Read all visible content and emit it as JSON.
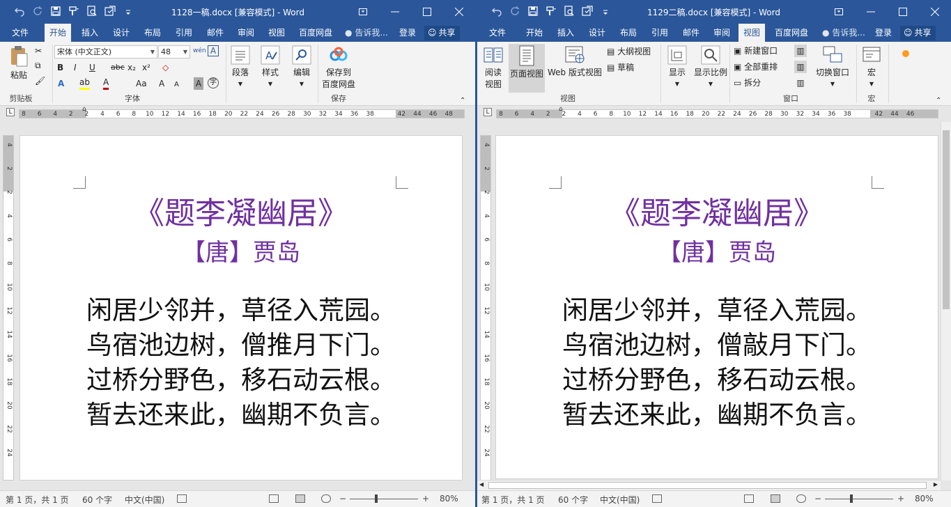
{
  "left_window": {
    "title": "1128一稿.docx [兼容模式] - Word",
    "tabs": [
      "文件",
      "开始",
      "插入",
      "设计",
      "布局",
      "引用",
      "邮件",
      "审阅",
      "视图",
      "百度网盘"
    ],
    "active_tab": "开始",
    "tell_me": "告诉我...",
    "login": "登录",
    "share": "共享",
    "ribbon": {
      "clipboard": {
        "paste": "粘贴",
        "label": "剪贴板"
      },
      "font": {
        "name": "宋体 (中文正文)",
        "size": "48",
        "label": "字体",
        "bold": "B",
        "italic": "I",
        "underline": "U",
        "strike": "abc",
        "sub": "x₂",
        "sup": "x²",
        "grow": "A",
        "shrink": "A"
      },
      "paragraph": "段落",
      "styles": "样式",
      "editing": "编辑",
      "save_to": "保存到",
      "baidu": "百度网盘",
      "save_label": "保存"
    },
    "ruler_numbers": [
      "8",
      "6",
      "4",
      "2",
      "2",
      "4",
      "6",
      "8",
      "10",
      "12",
      "14",
      "16",
      "18",
      "20",
      "22",
      "24",
      "26",
      "28",
      "30",
      "32",
      "34",
      "36",
      "38",
      "42",
      "44",
      "46",
      "48"
    ],
    "vruler_numbers": [
      "4",
      "2",
      "2",
      "4",
      "6",
      "8",
      "10",
      "12",
      "14",
      "16",
      "18",
      "20",
      "22",
      "24"
    ],
    "doc": {
      "title": "《题李凝幽居》",
      "author": "【唐】贾岛",
      "lines": [
        "闲居少邻并，草径入荒园。",
        "鸟宿池边树，僧推月下门。",
        "过桥分野色，移石动云根。",
        "暂去还来此，幽期不负言。"
      ]
    },
    "status": {
      "page": "第 1 页，共 1 页",
      "words": "60 个字",
      "lang": "中文(中国)",
      "zoom": "80%"
    }
  },
  "right_window": {
    "title": "1129二稿.docx [兼容模式] - Word",
    "tabs": [
      "文件",
      "开始",
      "插入",
      "设计",
      "布局",
      "引用",
      "邮件",
      "审阅",
      "视图",
      "百度网盘"
    ],
    "active_tab": "视图",
    "tell_me": "告诉我...",
    "login": "登录",
    "share": "共享",
    "ribbon": {
      "read": "阅读\n视图",
      "read1": "阅读",
      "read2": "视图",
      "page_view": "页面视图",
      "web_view": "Web 版式视图",
      "outline": "大纲视图",
      "draft": "草稿",
      "views_label": "视图",
      "show": "显示",
      "zoom": "显示比例",
      "new_window": "新建窗口",
      "arrange_all": "全部重排",
      "split": "拆分",
      "switch_windows": "切换窗口",
      "window_label": "窗口",
      "macros": "宏",
      "macros_label": "宏"
    },
    "ruler_numbers": [
      "8",
      "6",
      "4",
      "2",
      "2",
      "4",
      "6",
      "8",
      "10",
      "12",
      "14",
      "16",
      "18",
      "20",
      "22",
      "24",
      "26",
      "28",
      "30",
      "32",
      "34",
      "36",
      "38",
      "42",
      "44",
      "46"
    ],
    "vruler_numbers": [
      "4",
      "2",
      "2",
      "4",
      "6",
      "8",
      "10",
      "12",
      "14",
      "16",
      "18",
      "20",
      "22",
      "24"
    ],
    "doc": {
      "title": "《题李凝幽居》",
      "author": "【唐】贾岛",
      "lines": [
        "闲居少邻并，草径入荒园。",
        "鸟宿池边树，僧敲月下门。",
        "过桥分野色，移石动云根。",
        "暂去还来此，幽期不负言。"
      ]
    },
    "status": {
      "page": "第 1 页，共 1 页",
      "words": "60 个字",
      "lang": "中文(中国)",
      "zoom": "80%"
    }
  },
  "colors": {
    "word_blue": "#2b579a",
    "title_purple": "#7030a0",
    "ribbon_bg": "#f3f3f3"
  },
  "zoom_level": 0.8
}
